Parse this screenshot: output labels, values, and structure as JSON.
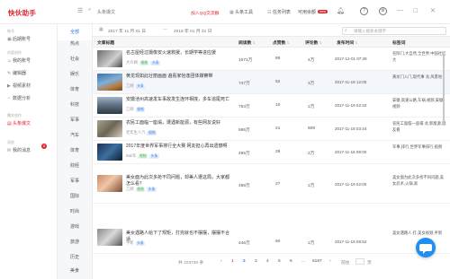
{
  "app": {
    "title": "快伙助手"
  },
  "topbar": {
    "collapse_icon": "collapse-icon",
    "search_icon": "search-icon",
    "search_text": "头条爆文",
    "red_link": "加入QQ交流群",
    "items": [
      "头条工具",
      "任务列表",
      "可用余额",
      "new"
    ],
    "icons": [
      "bell-icon",
      "help-icon",
      "settings-icon"
    ],
    "window_controls": [
      "minimize-icon",
      "maximize-icon",
      "close-icon"
    ]
  },
  "sidebar": {
    "groups": [
      "账号",
      "内容创作",
      "爆文创作",
      "消息"
    ],
    "items": [
      {
        "label": "后期账号",
        "icon": "account-icon"
      },
      {
        "label": "我的账号",
        "icon": "user-icon"
      },
      {
        "label": "编辑器",
        "icon": "edit-icon"
      },
      {
        "label": "视频素材",
        "icon": "video-icon"
      },
      {
        "label": "数据分析",
        "icon": "chart-icon"
      },
      {
        "label": "头条爆文",
        "icon": "article-icon"
      },
      {
        "label": "我的消息",
        "icon": "message-icon",
        "badge": "8"
      }
    ]
  },
  "categories": [
    "全部",
    "热点",
    "社会",
    "娱乐",
    "体育",
    "科技",
    "军事",
    "汽车",
    "体育",
    "财经",
    "军事",
    "国际",
    "时尚",
    "游戏",
    "旅游",
    "历史",
    "探索",
    "美食",
    "育儿"
  ],
  "active_category_index": 0,
  "filter": {
    "date_from": "2017 年 11 月 01 日",
    "date_to": "2018 年 01 月 31 日",
    "separator": "—",
    "search_placeholder": "请输入搜索关键字"
  },
  "table": {
    "headers": [
      "文章标题",
      "阅读数",
      "点赞数",
      "评论数",
      "发布时间",
      "标签词"
    ],
    "rows": [
      {
        "title": "名古屋经过摄像安火速救援，长期学等进应援",
        "source": "大众网",
        "tags": [
          "视频",
          "头条"
        ],
        "reads": "1071万",
        "likes": "89",
        "comments": "4万",
        "date": "2017-12-01 07:28",
        "labels": "名际门,大自然,全世界,中国社区大"
      },
      {
        "title": "黄龙现如此壮丽画面 遍看家恰逢团体媒察带",
        "source": "乙网",
        "tags": [
          "头条"
        ],
        "reads": "747万",
        "likes": "52",
        "comments": "3万",
        "date": "2017-11-18 12:00",
        "labels": "黄龙门入门,现代事 龙,风景地"
      },
      {
        "title": "安徽池州高速发车事故发生连环相撞，多车追尾死亡",
        "source": "乙网",
        "tags": [
          "视频"
        ],
        "reads": "753万",
        "likes": "10",
        "comments": "2万",
        "date": "2017-11-19 02:32",
        "labels": "安徽,高速公路,车祸,视频,安徽视频"
      },
      {
        "title": "农民工面临一座塌，遭遇新能源，有些网友说好",
        "source": "老年生人汽",
        "tags": [
          "视频"
        ],
        "reads": "595万",
        "likes": "21",
        "comments": "609",
        "date": "2017-11-18 03:44",
        "labels": "农民工面临一座塌 龙,新能源,网友看"
      },
      {
        "title": "2017年度世界军事排行全大赛 网友担心再出遗憾啊",
        "source": "Bali军",
        "tags": [
          "视频",
          "头条"
        ],
        "reads": "495万",
        "likes": "29",
        "comments": "2万",
        "date": "2017-11-16 09:00",
        "labels": "军事,排行,世界军事排行,视频"
      },
      {
        "title": "美女面为此次多抢不同问题，却美人遭这局，大家都怎么看？",
        "source": "乙网",
        "tags": [
          "视频",
          "头条"
        ],
        "reads": "488万",
        "likes": "27",
        "comments": "2万",
        "date": "2017-11-19 02:00",
        "labels": "美女面为此次多抢不同问题,美女武术,火锅,家"
      },
      {
        "title": "美女遇路人给下了规矩，打完就也不摆摆，摆摆不合适",
        "source": "手新",
        "tags": [
          "头条"
        ],
        "reads": "446万",
        "likes": "60",
        "comments": "2万",
        "date": "2017-11-19 08:52",
        "labels": "美女遇路人,打,美女视频,手新"
      }
    ]
  },
  "pagination": {
    "total": "共 103730 条",
    "pages": [
      "1",
      "2",
      "3",
      "4",
      "5",
      "6",
      "...",
      "5187"
    ],
    "active_page": "2",
    "prev": "‹",
    "next": "›",
    "jump_label": "前往",
    "page_suffix": "页"
  },
  "chat_icon": "chat-bubble-icon"
}
